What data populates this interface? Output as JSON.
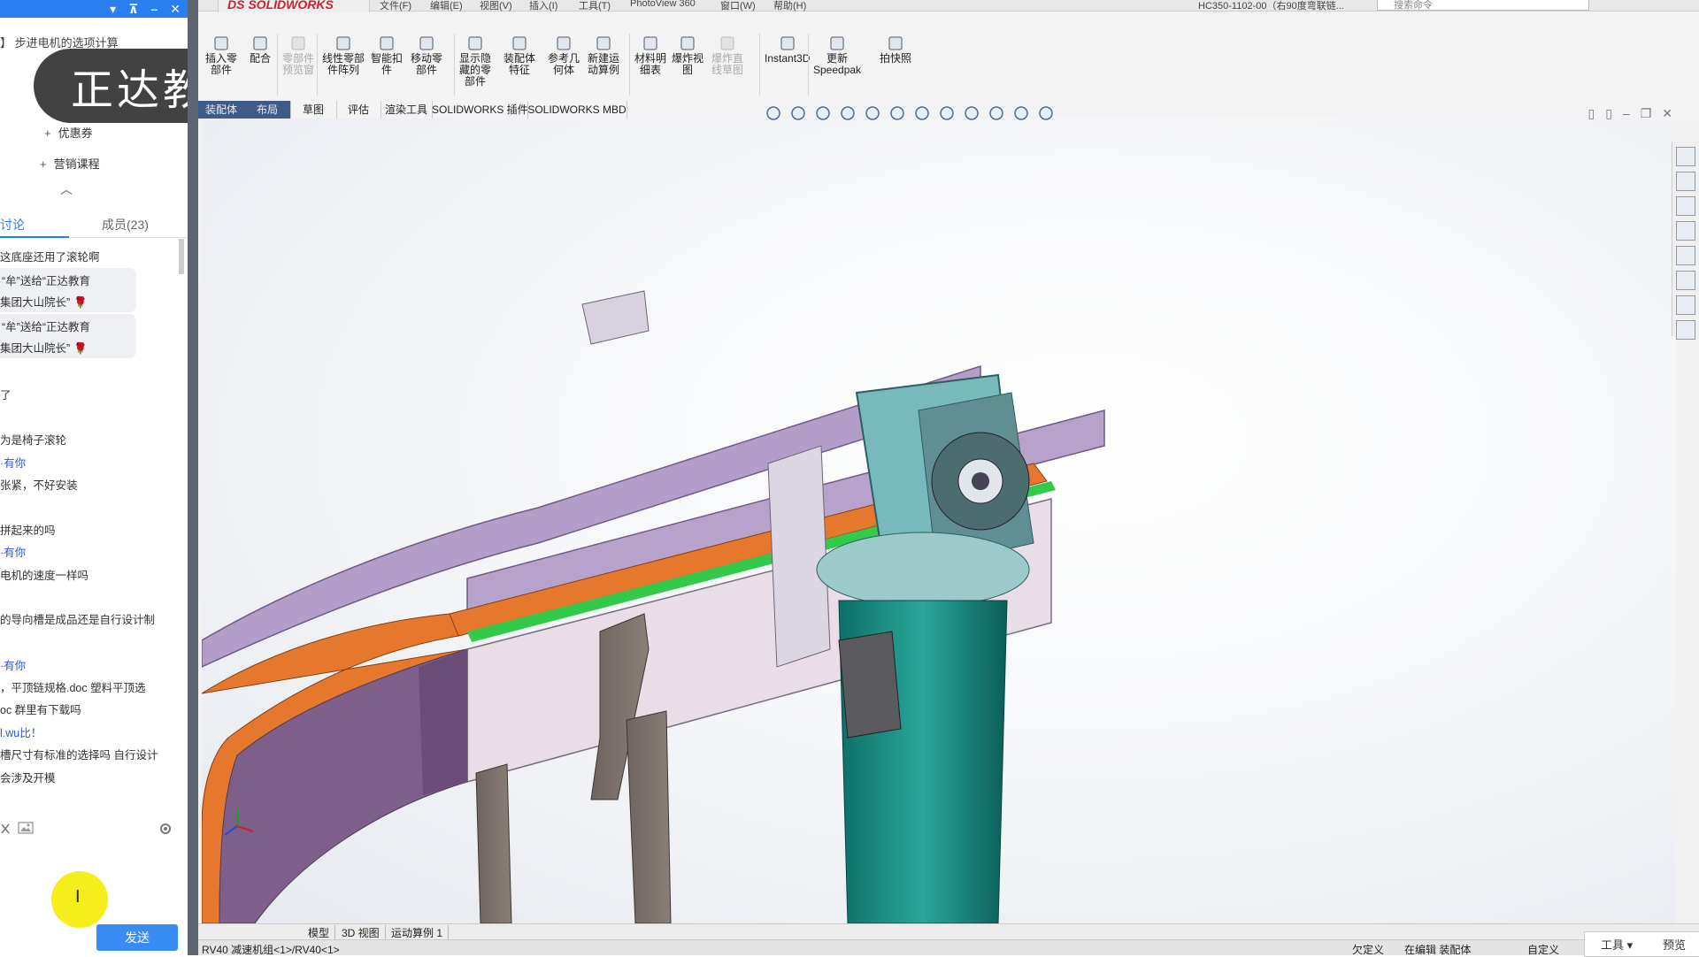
{
  "left_panel": {
    "window_controls": [
      "▾",
      "⊼",
      "–",
      "✕"
    ],
    "lecture_title": "】 步进电机的选项计算",
    "watermark": "正达教育",
    "tree_items": [
      {
        "prefix": "+",
        "label": "优惠券"
      },
      {
        "prefix": "+",
        "label": "营销课程"
      }
    ],
    "collapse": "︿",
    "tabs": [
      {
        "label": "讨论",
        "active": true
      },
      {
        "label": "成员(23)",
        "active": false
      }
    ],
    "messages": [
      "这底座还用了滚轮啊",
      "了",
      "为是椅子滚轮",
      "·有你",
      "张紧，不好安装",
      "拼起来的吗",
      "·有你",
      "电机的速度一样吗",
      "的导向槽是成品还是自行设计制",
      "·有你",
      "，平顶链规格.doc  塑料平顶选",
      "oc 群里有下载吗",
      "l.wu比！",
      "槽尺寸有标准的选择吗 自行设计",
      "会涉及开模"
    ],
    "gifts": [
      {
        "line1": "“牟”送给“正达教育",
        "line2": "集团大山院长”"
      },
      {
        "line1": "“牟”送给“正达教育",
        "line2": "集团大山院长”"
      }
    ],
    "send_label": "发送",
    "cursor_glyph": "I"
  },
  "solidworks": {
    "logo": "DS SOLIDWORKS",
    "menus": [
      "文件(F)",
      "编辑(E)",
      "视图(V)",
      "插入(I)",
      "工具(T)",
      "PhotoView 360",
      "窗口(W)",
      "帮助(H)"
    ],
    "doc_title": "HC350-1102-00（右90度弯联链...",
    "search_placeholder": "搜索命令",
    "ribbon": [
      {
        "label": "插入零\n部件",
        "icon": "insert-component-icon",
        "dim": false
      },
      {
        "label": "配合",
        "icon": "mate-icon",
        "dim": false
      },
      {
        "label": "零部件\n预览窗",
        "icon": "preview-window-icon",
        "dim": true
      },
      {
        "label": "线性零部\n件阵列",
        "icon": "linear-pattern-icon",
        "dim": false
      },
      {
        "label": "智能扣\n件",
        "icon": "smart-fasteners-icon",
        "dim": false
      },
      {
        "label": "移动零\n部件",
        "icon": "move-component-icon",
        "dim": false
      },
      {
        "label": "显示隐\n藏的零\n部件",
        "icon": "show-hidden-icon",
        "dim": false
      },
      {
        "label": "装配体\n特征",
        "icon": "assembly-feature-icon",
        "dim": false
      },
      {
        "label": "参考几\n何体",
        "icon": "reference-geometry-icon",
        "dim": false
      },
      {
        "label": "新建运\n动算例",
        "icon": "motion-study-icon",
        "dim": false
      },
      {
        "label": "材料明\n细表",
        "icon": "bom-icon",
        "dim": false
      },
      {
        "label": "爆炸视\n图",
        "icon": "exploded-view-icon",
        "dim": false
      },
      {
        "label": "爆炸直\n线草图",
        "icon": "explode-line-icon",
        "dim": true
      },
      {
        "label": "Instant3D",
        "icon": "instant3d-icon",
        "dim": false
      },
      {
        "label": "更新\nSpeedpak",
        "icon": "speedpak-icon",
        "dim": false
      },
      {
        "label": "拍快照",
        "icon": "camera-icon",
        "dim": false
      }
    ],
    "command_tabs": [
      "装配体",
      "布局",
      "草图",
      "评估",
      "渲染工具",
      "SOLIDWORKS 插件",
      "SOLIDWORKS MBD"
    ],
    "bottom_tabs": [
      "模型",
      "3D 视图",
      "运动算例 1"
    ],
    "status": {
      "path": "RV40 减速机组<1>/RV40<1>",
      "custom": "欠定义",
      "editing": "在编辑 装配体",
      "units": "自定义"
    },
    "tools_menu": {
      "label": "工具 ▾",
      "right": "预览"
    }
  }
}
